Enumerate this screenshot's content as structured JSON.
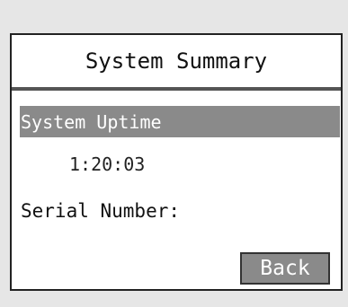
{
  "screen": {
    "title": "System Summary",
    "uptime_label": "System Uptime",
    "uptime_value": "1:20:03",
    "serial_label": "Serial Number:",
    "back_label": "Back"
  },
  "colors": {
    "highlight": "#8a8a8a",
    "background": "#e6e6e6",
    "screen": "#ffffff"
  }
}
